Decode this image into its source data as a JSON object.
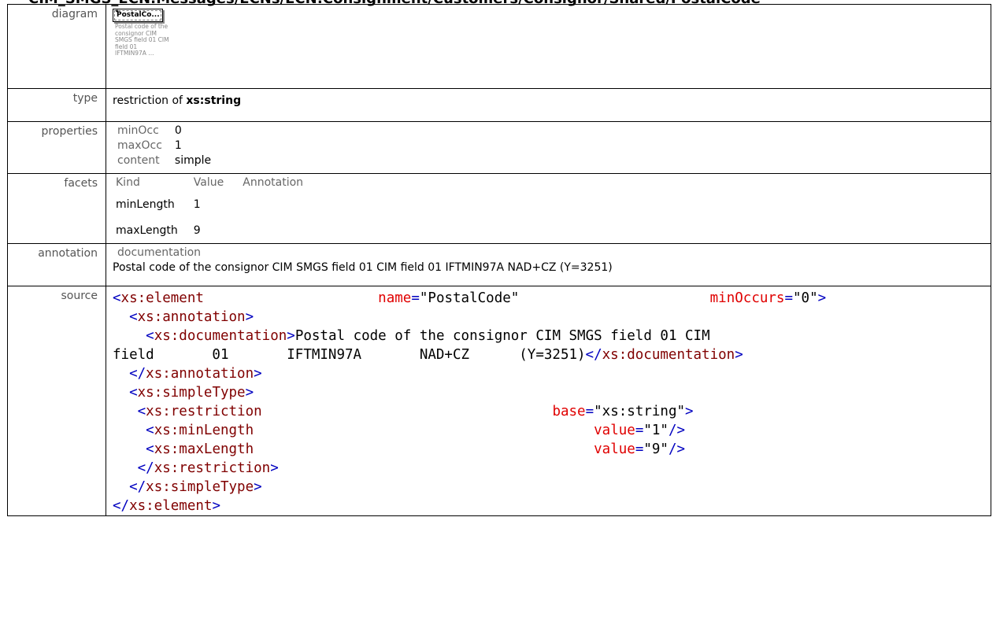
{
  "header": {
    "title": "CIM_SMGS_ECN:Messages/ECNs/ECN:Consignment/Customers/Consignor/Shared/PostalCode"
  },
  "labels": {
    "diagram": "diagram",
    "type": "type",
    "properties": "properties",
    "facets": "facets",
    "annotation": "annotation",
    "source": "source"
  },
  "diagram": {
    "box_label": "PostalCo...",
    "caption": "Postal code of the consignor CIM SMGS field 01 CIM field 01 IFTMIN97A ..."
  },
  "type": {
    "prefix": "restriction of",
    "base": "xs:string"
  },
  "properties": [
    {
      "key": "minOcc",
      "value": "0"
    },
    {
      "key": "maxOcc",
      "value": "1"
    },
    {
      "key": "content",
      "value": "simple"
    }
  ],
  "facets": {
    "headers": [
      "Kind",
      "Value",
      "Annotation"
    ],
    "rows": [
      {
        "kind": "minLength",
        "value": "1",
        "annotation": ""
      },
      {
        "kind": "maxLength",
        "value": "9",
        "annotation": ""
      }
    ]
  },
  "annotation": {
    "heading": "documentation",
    "text": "Postal code of the consignor CIM SMGS field 01 CIM field 01 IFTMIN97A NAD+CZ (Y=3251)"
  },
  "source": {
    "el_tag": "xs:element",
    "name_attr": "name",
    "name_val": "\"PostalCode\"",
    "minocc_attr": "minOccurs",
    "minocc_val": "\"0\"",
    "annotation_tag": "xs:annotation",
    "documentation_tag": "xs:documentation",
    "doc_text_1": "Postal code of the consignor CIM SMGS field 01 CIM",
    "doc_text_2": "field       01       IFTMIN97A       NAD+CZ      (Y=3251)",
    "simpletype_tag": "xs:simpleType",
    "restriction_tag": "xs:restriction",
    "base_attr": "base",
    "base_val": "\"xs:string\"",
    "minlength_tag": "xs:minLength",
    "maxlength_tag": "xs:maxLength",
    "value_attr": "value",
    "minlength_val": "\"1\"",
    "maxlength_val": "\"9\""
  }
}
